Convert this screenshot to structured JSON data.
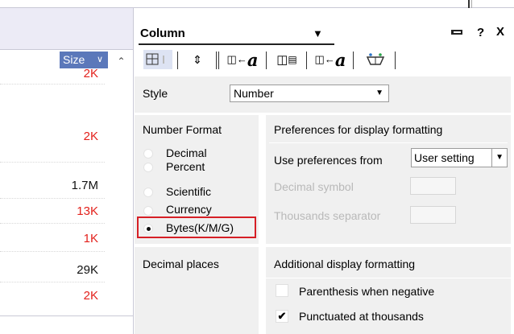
{
  "table": {
    "size_header": "Size",
    "rows": [
      {
        "value": "2K",
        "color": "red"
      },
      {
        "value": "2K",
        "color": "red"
      },
      {
        "value": "1.7M",
        "color": "black"
      },
      {
        "value": "13K",
        "color": "red"
      },
      {
        "value": "1K",
        "color": "red"
      },
      {
        "value": "29K",
        "color": "black"
      },
      {
        "value": "2K",
        "color": "red"
      }
    ]
  },
  "panel": {
    "title": "Column",
    "help": "?",
    "close": "X"
  },
  "style": {
    "label": "Style",
    "value": "Number"
  },
  "number_format": {
    "title": "Number Format",
    "options": [
      "Decimal",
      "Percent",
      "Scientific",
      "Currency",
      "Bytes(K/M/G)"
    ],
    "selected": "Bytes(K/M/G)"
  },
  "preferences": {
    "title": "Preferences for display formatting",
    "use_from_label": "Use preferences from",
    "use_from_value": "User setting",
    "decimal_symbol_label": "Decimal symbol",
    "thousands_separator_label": "Thousands separator"
  },
  "decimal_places": {
    "title": "Decimal places"
  },
  "additional": {
    "title": "Additional display formatting",
    "paren_negative": "Parenthesis when negative",
    "paren_checked": false,
    "punctuated": "Punctuated at thousands",
    "punctuated_checked": true
  },
  "colors": {
    "header_blue": "#5b78ba",
    "highlight_red": "#d61f26",
    "value_red": "#e3211c"
  },
  "icons": [
    "pin-icon",
    "help-icon",
    "close-icon",
    "sort-icon",
    "column-icon",
    "font-icon",
    "color-icon"
  ]
}
